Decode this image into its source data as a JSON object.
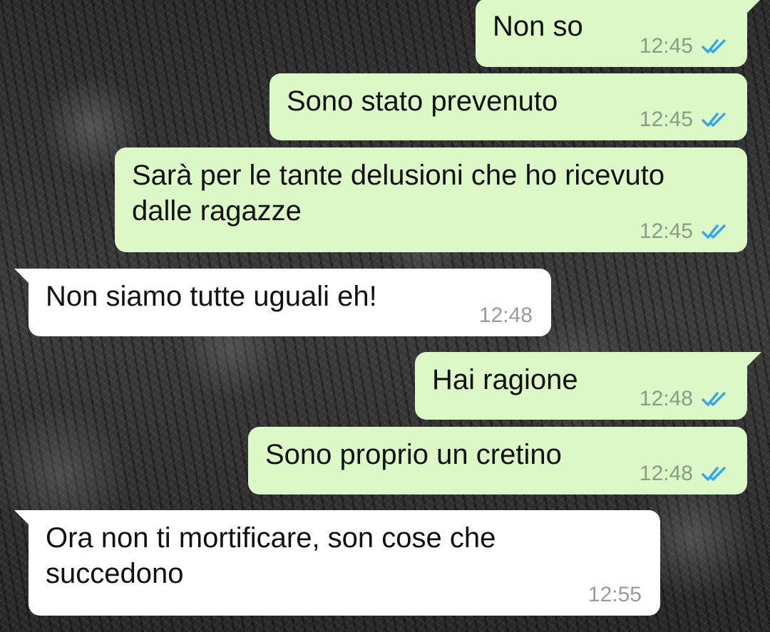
{
  "messages": [
    {
      "id": "m1",
      "direction": "outgoing",
      "text": "Non so",
      "time": "12:45",
      "status": "read"
    },
    {
      "id": "m2",
      "direction": "outgoing",
      "text": "Sono stato prevenuto",
      "time": "12:45",
      "status": "read"
    },
    {
      "id": "m3",
      "direction": "outgoing",
      "text": "Sarà per le tante delusioni che ho ricevuto dalle ragazze",
      "time": "12:45",
      "status": "read"
    },
    {
      "id": "m4",
      "direction": "incoming",
      "text": "Non siamo tutte uguali eh!",
      "time": "12:48"
    },
    {
      "id": "m5",
      "direction": "outgoing",
      "text": "Hai ragione",
      "time": "12:48",
      "status": "read"
    },
    {
      "id": "m6",
      "direction": "outgoing",
      "text": "Sono proprio un cretino",
      "time": "12:48",
      "status": "read"
    },
    {
      "id": "m7",
      "direction": "incoming",
      "text": "Ora non ti mortificare, son cose che succedono",
      "time": "12:55"
    }
  ],
  "colors": {
    "outgoing_bubble": "#dcf8c6",
    "incoming_bubble": "#ffffff",
    "read_ticks": "#34a7e8",
    "timestamp": "#9a9a9a"
  },
  "icons": {
    "read_receipt": "double-check-icon"
  }
}
